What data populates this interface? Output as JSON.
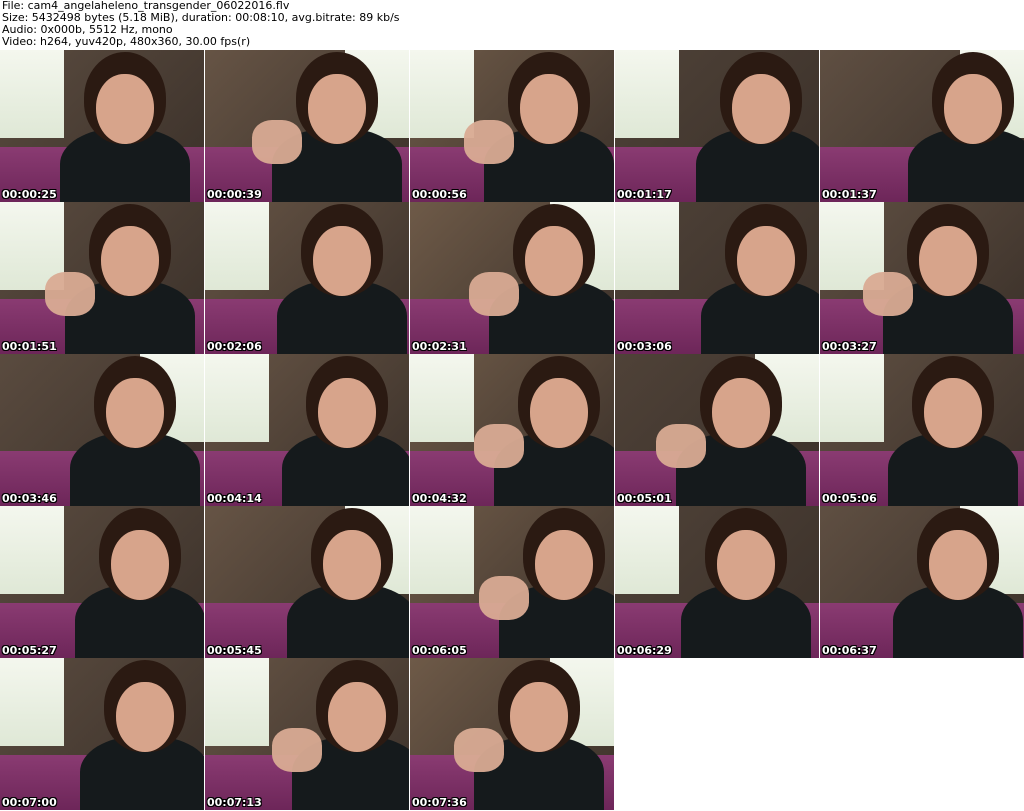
{
  "header": {
    "line1": "File: cam4_angelaheleno_transgender_06022016.flv",
    "line2": "Size: 5432498 bytes (5.18 MiB), duration: 00:08:10, avg.bitrate: 89 kb/s",
    "line3": "Audio: 0x000b, 5512 Hz, mono",
    "line4": "Video: h264, yuv420p, 480x360, 30.00 fps(r)"
  },
  "thumbnails": [
    {
      "timestamp": "00:00:25"
    },
    {
      "timestamp": "00:00:39"
    },
    {
      "timestamp": "00:00:56"
    },
    {
      "timestamp": "00:01:17"
    },
    {
      "timestamp": "00:01:37"
    },
    {
      "timestamp": "00:01:51"
    },
    {
      "timestamp": "00:02:06"
    },
    {
      "timestamp": "00:02:31"
    },
    {
      "timestamp": "00:03:06"
    },
    {
      "timestamp": "00:03:27"
    },
    {
      "timestamp": "00:03:46"
    },
    {
      "timestamp": "00:04:14"
    },
    {
      "timestamp": "00:04:32"
    },
    {
      "timestamp": "00:05:01"
    },
    {
      "timestamp": "00:05:06"
    },
    {
      "timestamp": "00:05:27"
    },
    {
      "timestamp": "00:05:45"
    },
    {
      "timestamp": "00:06:05"
    },
    {
      "timestamp": "00:06:29"
    },
    {
      "timestamp": "00:06:37"
    },
    {
      "timestamp": "00:07:00"
    },
    {
      "timestamp": "00:07:13"
    },
    {
      "timestamp": "00:07:36"
    }
  ]
}
